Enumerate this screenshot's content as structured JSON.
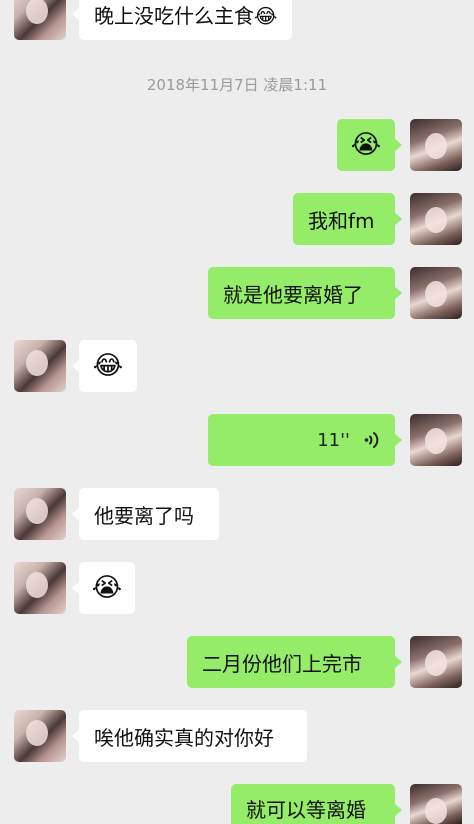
{
  "messages": [
    {
      "side": "left",
      "text": "晚上没吃什么主食😂"
    },
    {
      "timestamp": "2018年11月7日 凌晨1:11"
    },
    {
      "side": "right",
      "emoji": "😭"
    },
    {
      "side": "right",
      "text": "我和fm"
    },
    {
      "side": "right",
      "text": "就是他要离婚了"
    },
    {
      "side": "left",
      "emoji": "😂"
    },
    {
      "side": "right",
      "type": "voice",
      "duration": "11''"
    },
    {
      "side": "left",
      "text": "他要离了吗"
    },
    {
      "side": "left",
      "emoji": "😭"
    },
    {
      "side": "right",
      "text": "二月份他们上完市"
    },
    {
      "side": "left",
      "text": "唉他确实真的对你好"
    },
    {
      "side": "right",
      "text": "就可以等离婚"
    }
  ],
  "icons": {
    "voice": "voice-wave-icon",
    "avatar_right": "contact-avatar",
    "avatar_left": "friend-avatar"
  },
  "colors": {
    "background": "#ededed",
    "sent_bubble": "#95ec69",
    "received_bubble": "#ffffff",
    "timestamp_text": "#9a9a9a"
  }
}
